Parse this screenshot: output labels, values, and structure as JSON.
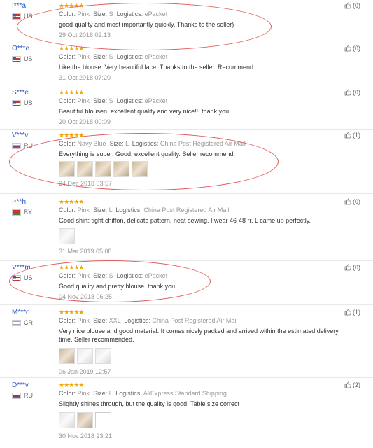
{
  "labels": {
    "color": "Color:",
    "size": "Size:",
    "logistics": "Logistics:"
  },
  "stars": "★★★★★",
  "reviews": [
    {
      "user": "I***a",
      "country": "US",
      "color": "Pink",
      "size": "S",
      "logistics": "ePacket",
      "text": "good quality and most importantly quickly. Thanks to the seller)",
      "date": "29 Oct 2018 02:13",
      "helpful": "(0)"
    },
    {
      "user": "O***e",
      "country": "US",
      "color": "Pink",
      "size": "S",
      "logistics": "ePacket",
      "text": "Like the blouse. Very beautiful lace. Thanks to the seller. Recommend",
      "date": "31 Oct 2018 07:20",
      "helpful": "(0)"
    },
    {
      "user": "S***e",
      "country": "US",
      "color": "Pink",
      "size": "S",
      "logistics": "ePacket",
      "text": "Beautiful blousen. excellent quality and very nice!!! thank you!",
      "date": "20 Oct 2018 00:09",
      "helpful": "(0)"
    },
    {
      "user": "V***v",
      "country": "RU",
      "color": "Navy Blue",
      "size": "L",
      "logistics": "China Post Registered Air Mail",
      "text": "Everything is super. Good, excellent quality. Seller recommend.",
      "date": "24 Dec 2018 03:57",
      "helpful": "(1)"
    },
    {
      "user": "I***h",
      "country": "BY",
      "color": "Pink",
      "size": "L",
      "logistics": "China Post Registered Air Mail",
      "text": "Good shirt: tight chiffon, delicate pattern, neat sewing. I wear 46-48 rr. L came up perfectly.",
      "date": "31 Mar 2019 05:08",
      "helpful": "(0)"
    },
    {
      "user": "V***m",
      "country": "US",
      "color": "Pink",
      "size": "S",
      "logistics": "ePacket",
      "text": "Good quality and pretty blouse. thank you!",
      "date": "04 Nov 2018 06:25",
      "helpful": "(0)"
    },
    {
      "user": "M***o",
      "country": "CR",
      "color": "Pink",
      "size": "XXL",
      "logistics": "China Post Registered Air Mail",
      "text": "Very nice blouse and good material. It comes nicely packed and arrived within the estimated delivery time. Seller recommended.",
      "date": "06 Jan 2019 12:57",
      "helpful": "(1)"
    },
    {
      "user": "D***v",
      "country": "RU",
      "color": "Pink",
      "size": "L",
      "logistics": "AliExpress Standard Shipping",
      "text": "Slightly shines through, but the quality is good! Table size correct",
      "date": "30 Nov 2018 23:21",
      "helpful": "(2)"
    }
  ]
}
